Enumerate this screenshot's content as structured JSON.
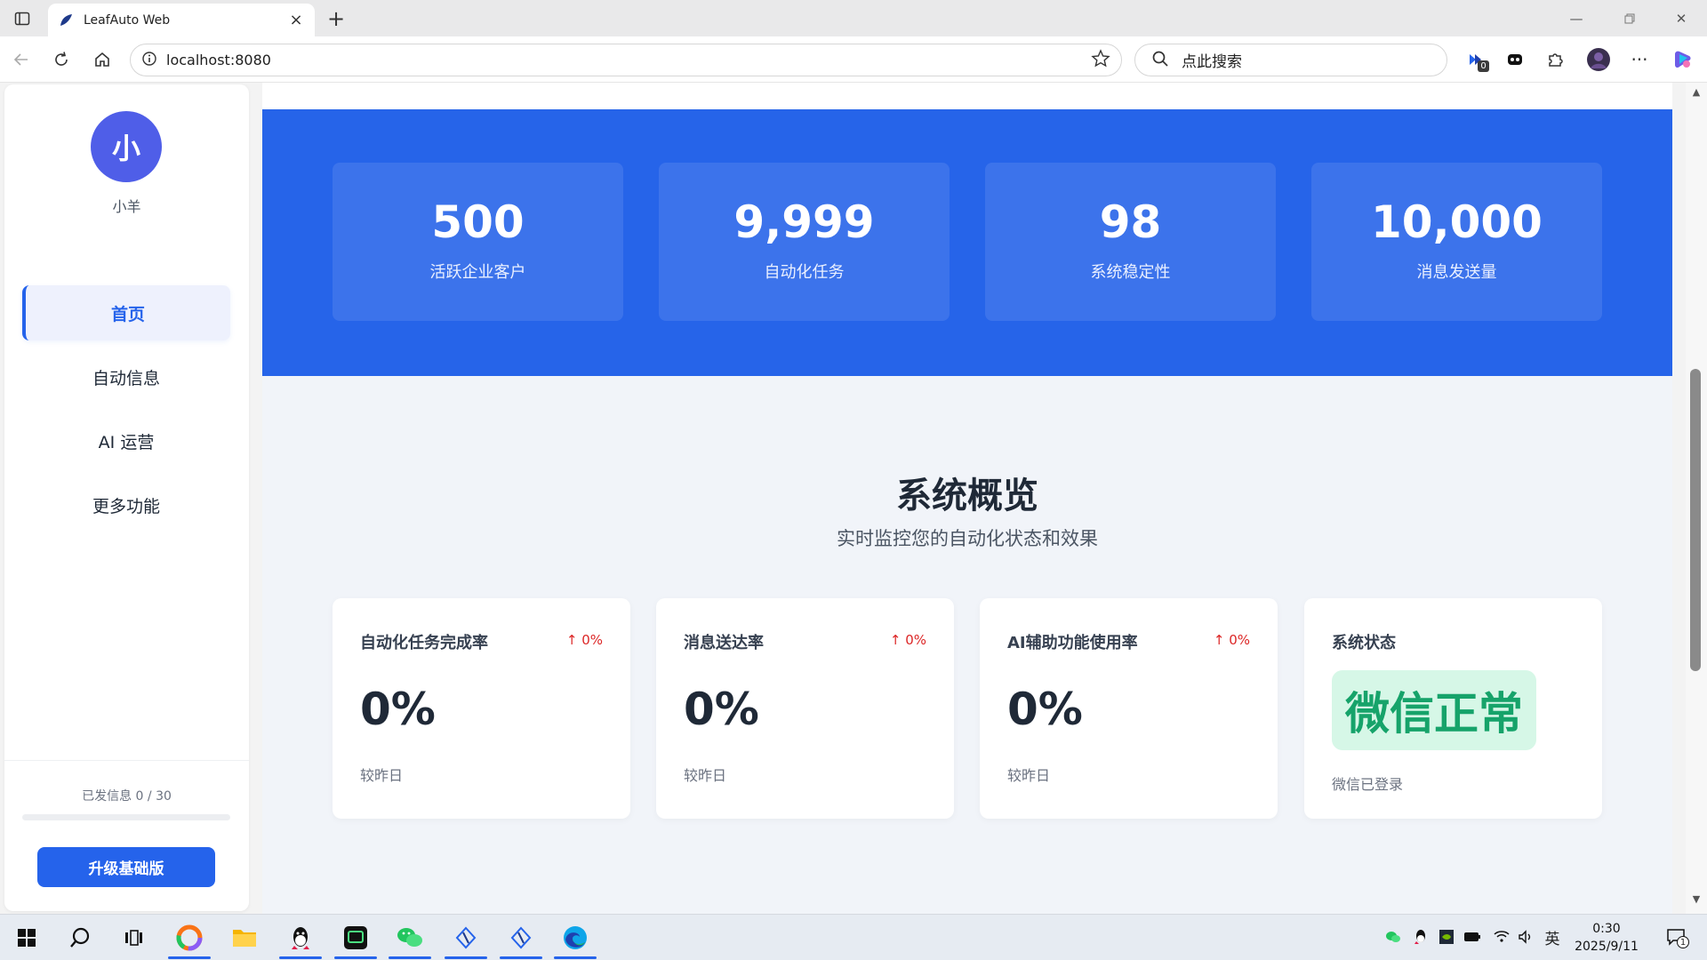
{
  "browser": {
    "tab_title": "LeafAuto Web",
    "url": "localhost:8080",
    "search_placeholder": "点此搜索",
    "extension_badge": "0"
  },
  "sidebar": {
    "avatar_char": "小",
    "username": "小羊",
    "nav": [
      {
        "label": "首页",
        "active": true
      },
      {
        "label": "自动信息",
        "active": false
      },
      {
        "label": "AI 运营",
        "active": false
      },
      {
        "label": "更多功能",
        "active": false
      }
    ],
    "sent_label": "已发信息 0 / 30",
    "sent_progress": 0,
    "upgrade_label": "升级基础版"
  },
  "hero": {
    "stats": [
      {
        "value": "500",
        "label": "活跃企业客户"
      },
      {
        "value": "9,999",
        "label": "自动化任务"
      },
      {
        "value": "98",
        "label": "系统稳定性"
      },
      {
        "value": "10,000",
        "label": "消息发送量"
      }
    ]
  },
  "overview": {
    "title": "系统概览",
    "subtitle": "实时监控您的自动化状态和效果",
    "cards": [
      {
        "title": "自动化任务完成率",
        "trend": "↑ 0%",
        "value": "0%",
        "note": "较昨日"
      },
      {
        "title": "消息送达率",
        "trend": "↑ 0%",
        "value": "0%",
        "note": "较昨日"
      },
      {
        "title": "AI辅助功能使用率",
        "trend": "↑ 0%",
        "value": "0%",
        "note": "较昨日"
      }
    ],
    "status_card": {
      "title": "系统状态",
      "badge": "微信正常",
      "note": "微信已登录"
    }
  },
  "taskbar": {
    "time": "0:30",
    "date": "2025/9/11",
    "ime": "英",
    "notification_count": "1"
  },
  "colors": {
    "accent": "#2563eb",
    "hero_bg": "#2664e9",
    "status_green": "#16a36a",
    "trend_red": "#dc2626"
  }
}
